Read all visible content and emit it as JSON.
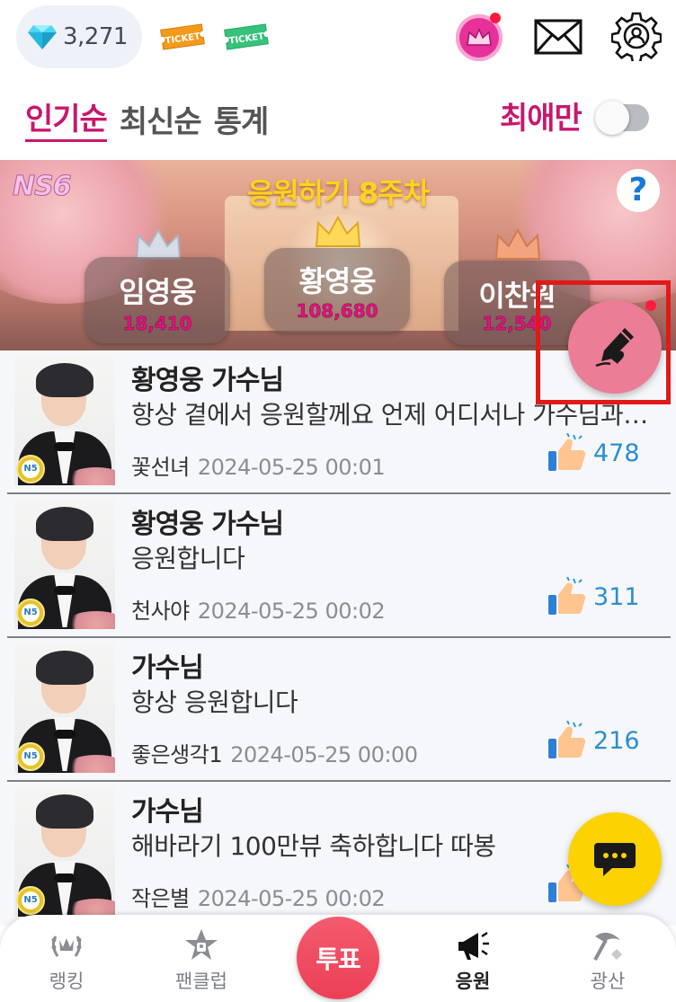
{
  "header": {
    "diamond_count": "3,271",
    "ticket_orange": "TICKET",
    "ticket_green": "TICKET"
  },
  "tabs": [
    {
      "label": "인기순",
      "active": true
    },
    {
      "label": "최신순",
      "active": false
    },
    {
      "label": "통계",
      "active": false
    }
  ],
  "favorites_toggle": {
    "label": "최애만",
    "on": false
  },
  "banner": {
    "logo": "NS6",
    "title": "응원하기 8주차",
    "help": "?",
    "ranks": [
      {
        "place": 2,
        "name": "임영웅",
        "score": "18,410",
        "crown_color": "#d7dde6"
      },
      {
        "place": 1,
        "name": "황영웅",
        "score": "108,680",
        "crown_color": "#ffd85a"
      },
      {
        "place": 3,
        "name": "이찬원",
        "score": "12,540",
        "crown_color": "#f3a47c"
      }
    ]
  },
  "posts": [
    {
      "title": "황영웅 가수님",
      "body": "항상 곁에서 응원할께요 언제 어디서나 가수님과 함께해요",
      "author": "꽃선녀",
      "date": "2024-05-25 00:01",
      "likes": "478",
      "badge": "N5"
    },
    {
      "title": "황영웅 가수님",
      "body": "응원합니다",
      "author": "천사야",
      "date": "2024-05-25 00:02",
      "likes": "311",
      "badge": "N5"
    },
    {
      "title": "가수님",
      "body": "항상 응원합니다",
      "author": "좋은생각1",
      "date": "2024-05-25 00:00",
      "likes": "216",
      "badge": "N5"
    },
    {
      "title": "가수님",
      "body": "해바라기 100만뷰 축하합니다 따봉",
      "author": "작은별",
      "date": "2024-05-25 00:02",
      "likes": "",
      "badge": "N5"
    }
  ],
  "bottom_nav": {
    "items": [
      {
        "label": "랭킹",
        "icon": "laurel-icon"
      },
      {
        "label": "팬클럽",
        "icon": "star-lock-icon"
      },
      {
        "label": "응원",
        "icon": "megaphone-icon",
        "active": true
      },
      {
        "label": "광산",
        "icon": "pickaxe-icon"
      }
    ],
    "vote_label": "투표"
  },
  "colors": {
    "accent": "#c8176c",
    "like_blue": "#2a8fd1",
    "write_button": "#ec7d96",
    "chat_button": "#fcd200",
    "vote_button": "#ec3f55",
    "highlight": "#e01919"
  }
}
